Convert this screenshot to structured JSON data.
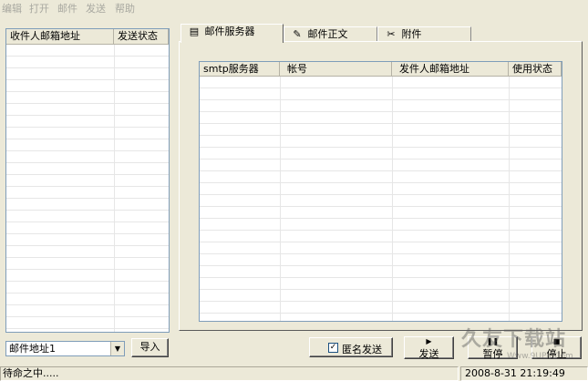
{
  "menubar": {
    "items": [
      "编辑",
      "打开",
      "邮件",
      "发送",
      "帮助"
    ]
  },
  "recipient_list": {
    "columns": [
      "收件人邮箱地址",
      "发送状态"
    ]
  },
  "tabs": [
    {
      "label": "邮件服务器",
      "icon": "server-icon"
    },
    {
      "label": "邮件正文",
      "icon": "edit-document-icon"
    },
    {
      "label": "附件",
      "icon": "paperclip-icon"
    }
  ],
  "server_table": {
    "columns": [
      "smtp服务器",
      "帐号",
      "发件人邮箱地址",
      "使用状态"
    ]
  },
  "address_select": {
    "value": "邮件地址1"
  },
  "buttons": {
    "import": "导入",
    "anonymous": "匿名发送",
    "send": "发送",
    "pause": "暂停",
    "stop": "停止"
  },
  "status": {
    "message": "待命之中.....",
    "datetime": "2008-8-31 21:19:49"
  },
  "watermark": {
    "text": "久友下载站",
    "url": "Www.9UPK.Com"
  }
}
